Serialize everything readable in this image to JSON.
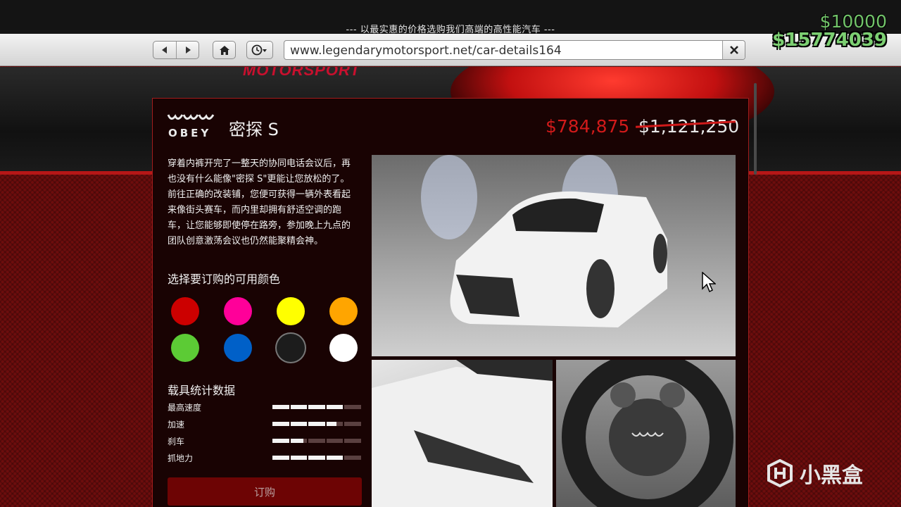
{
  "browser": {
    "tagline": "--- 以最实惠的价格选购我们高端的高性能汽车 ---",
    "url": "www.legendarymotorsport.net/car-details164"
  },
  "hud": {
    "cash": "$10000",
    "bank": "$15774039"
  },
  "banner": {
    "logo_text": "MOTORSPORT"
  },
  "vehicle": {
    "brand": "OBEY",
    "name": "密探 S",
    "sale_price": "$784,875",
    "original_price": "$1,121,250",
    "description": "穿着内裤开完了一整天的协同电话会议后，再也没有什么能像\"密探 S\"更能让您放松的了。前往正确的改装铺，您便可获得一辆外表看起来像街头赛车，而内里却拥有舒适空调的跑车，让您能够即使停在路旁，参加晚上九点的团队创意激荡会议也仍然能聚精会神。"
  },
  "colors": {
    "title": "选择要订购的可用颜色",
    "swatches": [
      {
        "name": "red",
        "hex": "#cc0000"
      },
      {
        "name": "magenta",
        "hex": "#ff0099"
      },
      {
        "name": "yellow",
        "hex": "#ffff00"
      },
      {
        "name": "orange",
        "hex": "#ffa500"
      },
      {
        "name": "green",
        "hex": "#5ccb35"
      },
      {
        "name": "blue",
        "hex": "#0060c8"
      },
      {
        "name": "black",
        "hex": "#1c1c1c"
      },
      {
        "name": "white",
        "hex": "#ffffff"
      }
    ]
  },
  "stats": {
    "title": "载具统计数据",
    "items": [
      {
        "label": "最高速度",
        "value": 0.8
      },
      {
        "label": "加速",
        "value": 0.72
      },
      {
        "label": "刹车",
        "value": 0.36
      },
      {
        "label": "抓地力",
        "value": 0.8
      }
    ]
  },
  "order": {
    "label": "订购"
  },
  "watermark": {
    "text": "小黑盒"
  },
  "theme": {
    "accent_red": "#d11a1a",
    "card_bg": "#190303",
    "money_green": "#72c46a"
  }
}
